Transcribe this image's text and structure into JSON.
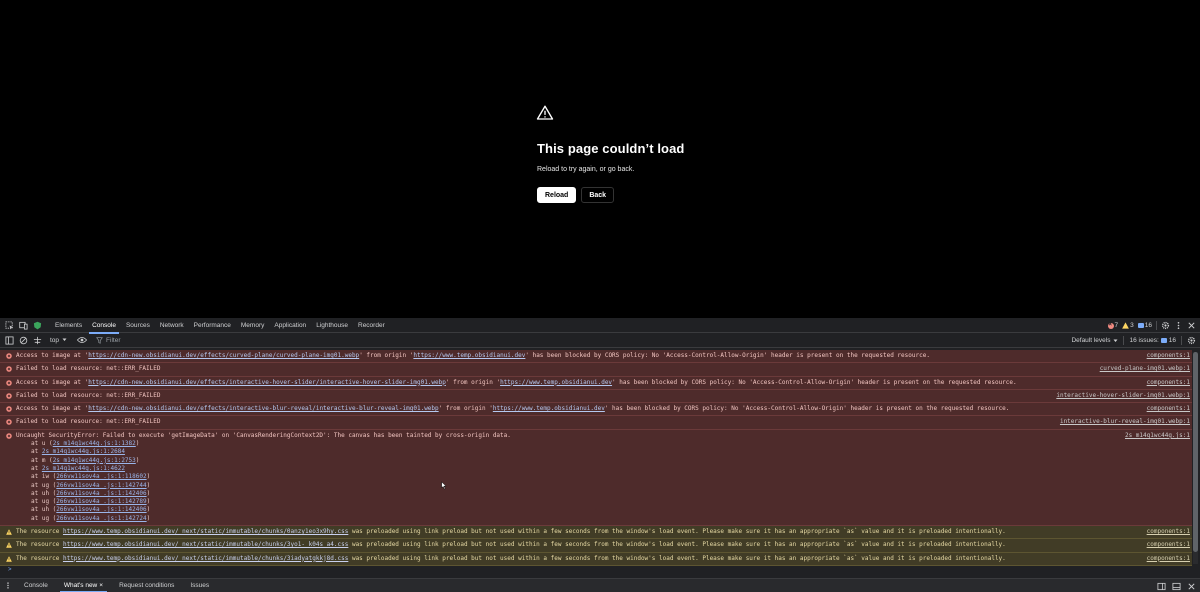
{
  "error_page": {
    "title": "This page couldn’t load",
    "subtitle": "Reload to try again, or go back.",
    "reload_label": "Reload",
    "back_label": "Back"
  },
  "devtools": {
    "tabs": [
      "Elements",
      "Console",
      "Sources",
      "Network",
      "Performance",
      "Memory",
      "Application",
      "Lighthouse",
      "Recorder"
    ],
    "active_tab": "Console",
    "counts": {
      "errors": "7",
      "warnings": "3",
      "issues": "16"
    },
    "filter": {
      "context": "top",
      "placeholder": "Filter",
      "levels": "Default levels",
      "issues_label": "16 issues:",
      "issues_count": "16"
    },
    "messages": [
      {
        "level": "error",
        "parts": [
          {
            "t": "Access to image at '"
          },
          {
            "t": "https://cdn-new.obsidianui.dev/effects/curved-plane/curved-plane-img01.webp",
            "link": true
          },
          {
            "t": "' from origin '"
          },
          {
            "t": "https://www.temp.obsidianui.dev",
            "link": true
          },
          {
            "t": "' has been blocked by CORS policy: No 'Access-Control-Allow-Origin' header is present on the requested resource."
          }
        ],
        "source": "components:1"
      },
      {
        "level": "error",
        "parts": [
          {
            "t": "Failed to load resource: net::ERR_FAILED"
          }
        ],
        "source": "curved-plane-img01.webp:1"
      },
      {
        "level": "error",
        "parts": [
          {
            "t": "Access to image at '"
          },
          {
            "t": "https://cdn-new.obsidianui.dev/effects/interactive-hover-slider/interactive-hover-slider-img01.webp",
            "link": true
          },
          {
            "t": "' from origin '"
          },
          {
            "t": "https://www.temp.obsidianui.dev",
            "link": true
          },
          {
            "t": "' has been blocked by CORS policy: No 'Access-Control-Allow-Origin' header is present on the requested resource."
          }
        ],
        "source": "components:1"
      },
      {
        "level": "error",
        "parts": [
          {
            "t": "Failed to load resource: net::ERR_FAILED"
          }
        ],
        "source": "interactive-hover-slider-img01.webp:1"
      },
      {
        "level": "error",
        "parts": [
          {
            "t": "Access to image at '"
          },
          {
            "t": "https://cdn-new.obsidianui.dev/effects/interactive-blur-reveal/interactive-blur-reveal-img01.webp",
            "link": true
          },
          {
            "t": "' from origin '"
          },
          {
            "t": "https://www.temp.obsidianui.dev",
            "link": true
          },
          {
            "t": "' has been blocked by CORS policy: No 'Access-Control-Allow-Origin' header is present on the requested resource."
          }
        ],
        "source": "components:1"
      },
      {
        "level": "error",
        "parts": [
          {
            "t": "Failed to load resource: net::ERR_FAILED"
          }
        ],
        "source": "interactive-blur-reveal-img01.webp:1"
      },
      {
        "level": "error",
        "parts": [
          {
            "t": "Uncaught SecurityError: Failed to execute 'getImageData' on 'CanvasRenderingContext2D': The canvas has been tainted by cross-origin data."
          }
        ],
        "source": "2s_m14q1wc44g.js:1",
        "stack": [
          {
            "fn": "at u (",
            "loc": "2s_m14q1wc44g.js:1:1382",
            "end": ")"
          },
          {
            "fn": "at ",
            "loc": "2s_m14q1wc44g.js:1:2684",
            "end": ""
          },
          {
            "fn": "at m (",
            "loc": "2s_m14q1wc44g.js:1:2753",
            "end": ")"
          },
          {
            "fn": "at ",
            "loc": "2s_m14q1wc44g.js:1:4622",
            "end": ""
          },
          {
            "fn": "at iw (",
            "loc": "266vw11sov4a_.js:1:118602",
            "end": ")"
          },
          {
            "fn": "at ug (",
            "loc": "266vw11sov4a_.js:1:142744",
            "end": ")"
          },
          {
            "fn": "at uh (",
            "loc": "266vw11sov4a_.js:1:142406",
            "end": ")"
          },
          {
            "fn": "at ug (",
            "loc": "266vw11sov4a_.js:1:142789",
            "end": ")"
          },
          {
            "fn": "at uh (",
            "loc": "266vw11sov4a_.js:1:142406",
            "end": ")"
          },
          {
            "fn": "at ug (",
            "loc": "266vw11sov4a_.js:1:142724",
            "end": ")"
          }
        ]
      },
      {
        "level": "warn",
        "parts": [
          {
            "t": "The resource "
          },
          {
            "t": "https://www.temp.obsidianui.dev/_next/static/immutable/chunks/0anzy1eo3x9hy.css",
            "link": true
          },
          {
            "t": " was preloaded using link preload but not used within a few seconds from the window's load event. Please make sure it has an appropriate `as` value and it is preloaded intentionally."
          }
        ],
        "source": "components:1"
      },
      {
        "level": "warn",
        "parts": [
          {
            "t": "The resource "
          },
          {
            "t": "https://www.temp.obsidianui.dev/_next/static/immutable/chunks/3yo1-_k04s_a4.css",
            "link": true
          },
          {
            "t": " was preloaded using link preload but not used within a few seconds from the window's load event. Please make sure it has an appropriate `as` value and it is preloaded intentionally."
          }
        ],
        "source": "components:1"
      },
      {
        "level": "warn",
        "parts": [
          {
            "t": "The resource "
          },
          {
            "t": "https://www.temp.obsidianui.dev/_next/static/immutable/chunks/3iadyatgkkj8d.css",
            "link": true
          },
          {
            "t": " was preloaded using link preload but not used within a few seconds from the window's load event. Please make sure it has an appropriate `as` value and it is preloaded intentionally."
          }
        ],
        "source": "components:1"
      }
    ],
    "prompt_symbol": ">",
    "drawer_tabs": [
      "Console",
      "What's new",
      "Request conditions",
      "Issues"
    ],
    "drawer_active": "What's new",
    "drawer_close_symbol": "×"
  },
  "colors": {
    "error_bg": "#4e2b2b",
    "warn_bg": "#413c26",
    "accent": "#7cacf8",
    "error_icon": "#f28b82",
    "warn_icon": "#fdd663"
  }
}
